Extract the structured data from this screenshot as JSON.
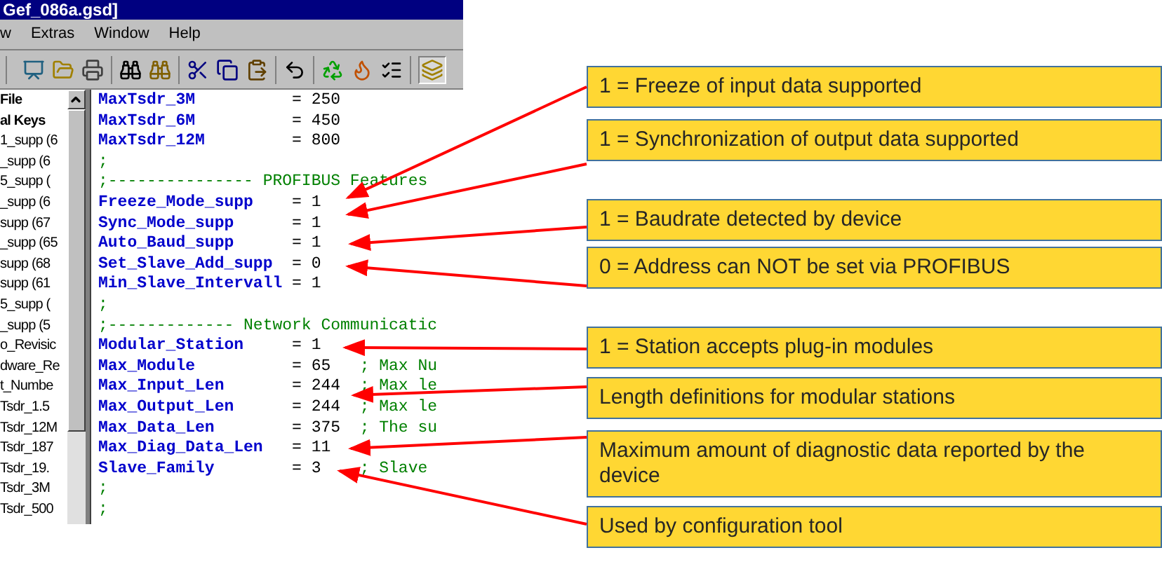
{
  "window": {
    "title": "Gef_086a.gsd]"
  },
  "menu": [
    "w",
    "Extras",
    "Window",
    "Help"
  ],
  "tree": [
    {
      "label": "File",
      "kind": "group"
    },
    {
      "label": "al Keys",
      "kind": "group"
    },
    {
      "label": "1_supp (6",
      "kind": "item"
    },
    {
      "label": "_supp (6",
      "kind": "item"
    },
    {
      "label": "5_supp (",
      "kind": "item"
    },
    {
      "label": "_supp (6",
      "kind": "item"
    },
    {
      "label": "supp (67",
      "kind": "item"
    },
    {
      "label": "_supp (65",
      "kind": "item"
    },
    {
      "label": "supp (68",
      "kind": "item"
    },
    {
      "label": "supp (61",
      "kind": "item"
    },
    {
      "label": "5_supp (",
      "kind": "item"
    },
    {
      "label": "_supp (5",
      "kind": "item"
    },
    {
      "label": "o_Revisic",
      "kind": "item"
    },
    {
      "label": "dware_Re",
      "kind": "item"
    },
    {
      "label": "t_Numbe",
      "kind": "item"
    },
    {
      "label": "Tsdr_1.5",
      "kind": "item"
    },
    {
      "label": "Tsdr_12M",
      "kind": "item"
    },
    {
      "label": "Tsdr_187",
      "kind": "item"
    },
    {
      "label": "Tsdr_19.",
      "kind": "item"
    },
    {
      "label": "Tsdr_3M",
      "kind": "item"
    },
    {
      "label": "Tsdr_500",
      "kind": "item"
    }
  ],
  "code": [
    {
      "kind": "entry",
      "key": "MaxTsdr_3M",
      "value": "= 250"
    },
    {
      "kind": "entry",
      "key": "MaxTsdr_6M",
      "value": "= 450"
    },
    {
      "kind": "entry",
      "key": "MaxTsdr_12M",
      "value": "= 800"
    },
    {
      "kind": "comment",
      "text": ";"
    },
    {
      "kind": "comment",
      "text": ";--------------- PROFIBUS Features"
    },
    {
      "kind": "entry",
      "key": "Freeze_Mode_supp",
      "value": "= 1"
    },
    {
      "kind": "entry",
      "key": "Sync_Mode_supp",
      "value": "= 1"
    },
    {
      "kind": "entry",
      "key": "Auto_Baud_supp",
      "value": "= 1"
    },
    {
      "kind": "entry",
      "key": "Set_Slave_Add_supp",
      "value": "= 0"
    },
    {
      "kind": "entry",
      "key": "Min_Slave_Intervall",
      "value": "= 1"
    },
    {
      "kind": "comment",
      "text": ";"
    },
    {
      "kind": "comment",
      "text": ";------------- Network Communicatic"
    },
    {
      "kind": "entry",
      "key": "Modular_Station",
      "value": "= 1"
    },
    {
      "kind": "entry",
      "key": "Max_Module",
      "value": "= 65",
      "comment": "; Max Nu"
    },
    {
      "kind": "entry",
      "key": "Max_Input_Len",
      "value": "= 244",
      "comment": "; Max le"
    },
    {
      "kind": "entry",
      "key": "Max_Output_Len",
      "value": "= 244",
      "comment": "; Max le"
    },
    {
      "kind": "entry",
      "key": "Max_Data_Len",
      "value": "= 375",
      "comment": "; The su"
    },
    {
      "kind": "entry",
      "key": "Max_Diag_Data_Len",
      "value": "= 11"
    },
    {
      "kind": "entry",
      "key": "Slave_Family",
      "value": "= 3",
      "comment": "; Slave"
    },
    {
      "kind": "comment",
      "text": ";"
    },
    {
      "kind": "comment",
      "text": ";"
    }
  ],
  "callouts": [
    {
      "text": "1 = Freeze of input data supported"
    },
    {
      "text": "1 = Synchronization of output data supported"
    },
    {
      "text": "1 = Baudrate detected by device"
    },
    {
      "text": "0 = Address can NOT be set via PROFIBUS"
    },
    {
      "text": "1 = Station accepts plug-in modules"
    },
    {
      "text": "Length definitions for modular stations"
    },
    {
      "text": "Maximum amount of diagnostic data reported by the device"
    },
    {
      "text": "Used by configuration tool"
    }
  ]
}
